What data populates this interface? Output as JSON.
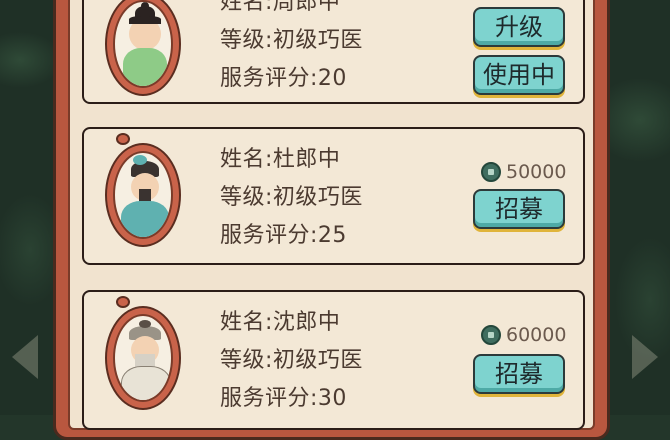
{
  "doctors": [
    {
      "name_line": "姓名:周郎中",
      "level_line": "等级:初级巧医",
      "rating_line": "服务评分:20",
      "upgrade_label": "升级",
      "status_label": "使用中",
      "robe_color": "#8ecb87",
      "hair_color": "#2b2321"
    },
    {
      "name_line": "姓名:杜郎中",
      "level_line": "等级:初级巧医",
      "rating_line": "服务评分:25",
      "price": "50000",
      "recruit_label": "招募",
      "robe_color": "#5fb1b0",
      "hair_color": "#3a3330"
    },
    {
      "name_line": "姓名:沈郎中",
      "level_line": "等级:初级巧医",
      "rating_line": "服务评分:30",
      "price": "60000",
      "recruit_label": "招募",
      "robe_color": "#e8e3d6",
      "hair_color": "#9a9387"
    }
  ],
  "colors": {
    "frame": "#b9573f",
    "panel": "#f1e3cf",
    "button": "#7ed3cf",
    "text": "#4b3a30"
  }
}
